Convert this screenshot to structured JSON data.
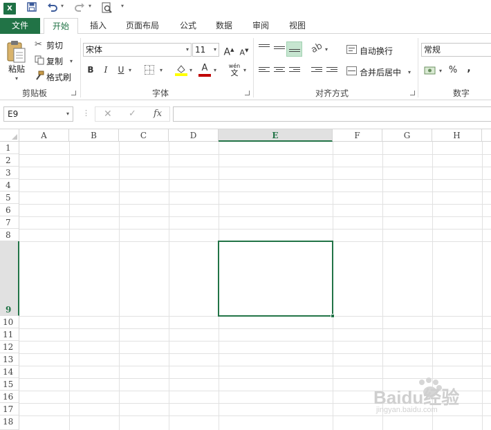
{
  "quick_access": {
    "excel_logo": "X",
    "save_icon": "save-icon",
    "undo_icon": "undo-icon",
    "redo_icon": "redo-icon",
    "print_preview_icon": "print-preview-icon"
  },
  "tabs": [
    {
      "label": "文件"
    },
    {
      "label": "开始"
    },
    {
      "label": "插入"
    },
    {
      "label": "页面布局"
    },
    {
      "label": "公式"
    },
    {
      "label": "数据"
    },
    {
      "label": "审阅"
    },
    {
      "label": "视图"
    }
  ],
  "ribbon": {
    "clipboard": {
      "paste": "粘贴",
      "cut": "剪切",
      "copy": "复制",
      "format_painter": "格式刷",
      "group_label": "剪贴板"
    },
    "font": {
      "font_name": "宋体",
      "font_size": "11",
      "grow": "A",
      "shrink": "A",
      "bold": "B",
      "italic": "I",
      "underline": "U",
      "font_color": "A",
      "phonetic": "wén",
      "group_label": "字体"
    },
    "alignment": {
      "wrap_text": "自动换行",
      "merge_center": "合并后居中",
      "group_label": "对齐方式"
    },
    "number": {
      "format": "常规",
      "percent": "%",
      "comma": ",",
      "group_label": "数字"
    }
  },
  "formula_bar": {
    "name_box": "E9",
    "fx": "fx",
    "cancel": "✕",
    "enter": "✓",
    "formula": ""
  },
  "sheet": {
    "columns": [
      "A",
      "B",
      "C",
      "D",
      "E",
      "F",
      "G",
      "H"
    ],
    "rows": [
      "1",
      "2",
      "3",
      "4",
      "5",
      "6",
      "7",
      "8",
      "9",
      "10",
      "11",
      "12",
      "13",
      "14",
      "15",
      "16",
      "17",
      "18"
    ],
    "selected_cell": "E9"
  },
  "watermark": {
    "brand": "Baidu经验",
    "url": "jingyan.baidu.com"
  },
  "colors": {
    "accent": "#217346"
  }
}
